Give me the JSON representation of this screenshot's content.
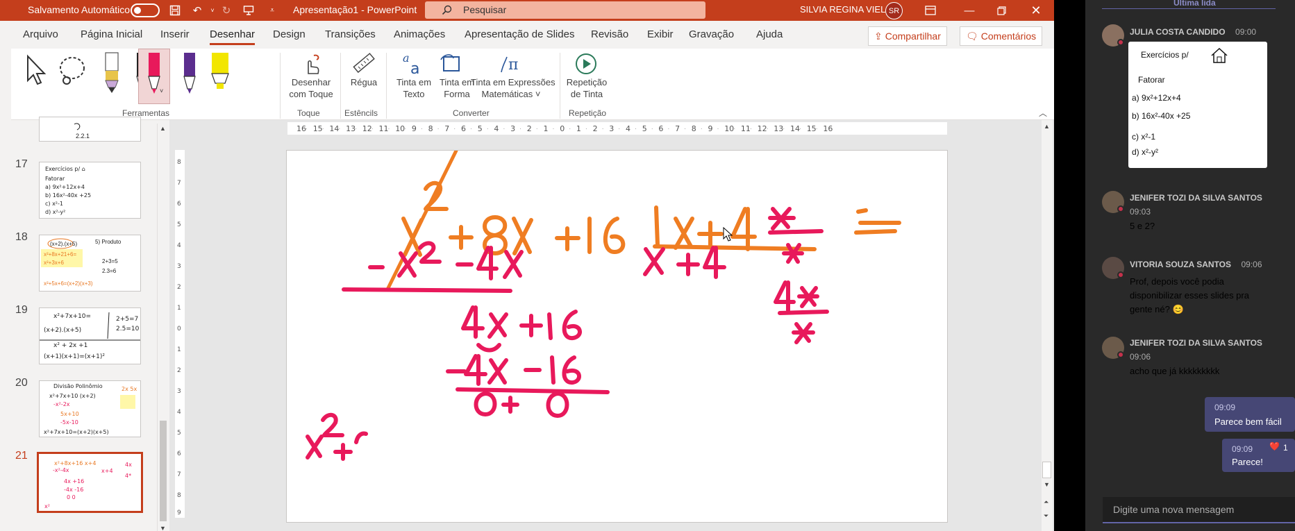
{
  "titlebar": {
    "autosave_label": "Salvamento Automático",
    "doc_title": "Apresentação1  -  PowerPoint",
    "search_placeholder": "Pesquisar",
    "user_name": "SILVIA REGINA VIEL",
    "user_initials": "SR"
  },
  "tabs": [
    "Arquivo",
    "Página Inicial",
    "Inserir",
    "Desenhar",
    "Design",
    "Transições",
    "Animações",
    "Apresentação de Slides",
    "Revisão",
    "Exibir",
    "Gravação",
    "Ajuda"
  ],
  "header_buttons": {
    "share": "Compartilhar",
    "comments": "Comentários"
  },
  "ribbon": {
    "draw_touch": [
      "Desenhar",
      "com Toque"
    ],
    "ruler": "Régua",
    "ink_text": [
      "Tinta em",
      "Texto"
    ],
    "ink_shape": [
      "Tinta em",
      "Forma"
    ],
    "ink_math": [
      "Tinta em Expressões",
      "Matemáticas ˅"
    ],
    "ink_replay": [
      "Repetição",
      "de Tinta"
    ],
    "groups": {
      "tools": "Ferramentas",
      "touch": "Toque",
      "stencils": "Estêncils",
      "convert": "Converter",
      "replay": "Repetição"
    }
  },
  "pen_colors": [
    "#e8c44a",
    "#222222",
    "#e8195b",
    "#5b2d8e",
    "#f2e600"
  ],
  "slides": [
    {
      "num": "17",
      "active": false
    },
    {
      "num": "18",
      "active": false
    },
    {
      "num": "19",
      "active": false
    },
    {
      "num": "20",
      "active": false
    },
    {
      "num": "21",
      "active": true
    }
  ],
  "ruler_numbers": [
    "16",
    "15",
    "14",
    "13",
    "12",
    "11",
    "10",
    "9",
    "8",
    "7",
    "6",
    "5",
    "4",
    "3",
    "2",
    "1",
    "0",
    "1",
    "2",
    "3",
    "4",
    "5",
    "6",
    "7",
    "8",
    "9",
    "10",
    "11",
    "12",
    "13",
    "14",
    "15",
    "16"
  ],
  "slide_ink": {
    "row1": "x² + 8x +16",
    "divisor": "x+4",
    "quotient": "x +4",
    "row2": "-x² -4x",
    "row3": "4x +16",
    "row4": "-4x -16",
    "row5": "0 0",
    "bottom": "x²+",
    "side1": "4x / 4",
    "side2": "4* / *"
  },
  "teams": {
    "header": "Última lida",
    "messages": [
      {
        "name": "JULIA COSTA CANDIDO",
        "time": "09:00",
        "text": "",
        "has_image": true,
        "image_lines": [
          "Exercícios p/",
          "Fatorar",
          "a) 9x²+12x+4",
          "b) 16x²-40x +25",
          "c) x²-1",
          "d) x²-y²"
        ]
      },
      {
        "name": "JENIFER TOZI DA SILVA SANTOS",
        "time": "09:03",
        "text": "5 e 2?"
      },
      {
        "name": "VITORIA SOUZA SANTOS",
        "time": "09:06",
        "text": [
          "Prof, depois você podia",
          "disponibilizar esses slides pra",
          "gente né? 😊"
        ]
      },
      {
        "name": "JENIFER TOZI DA SILVA SANTOS",
        "time": "09:06",
        "text": "acho que já kkkkkkkkk"
      }
    ],
    "own_messages": [
      {
        "time": "09:09",
        "text": "Parece bem fácil"
      },
      {
        "time": "09:09",
        "text": "Parece!",
        "reaction": "❤️",
        "reaction_count": "1"
      }
    ],
    "compose_placeholder": "Digite uma nova mensagem"
  }
}
